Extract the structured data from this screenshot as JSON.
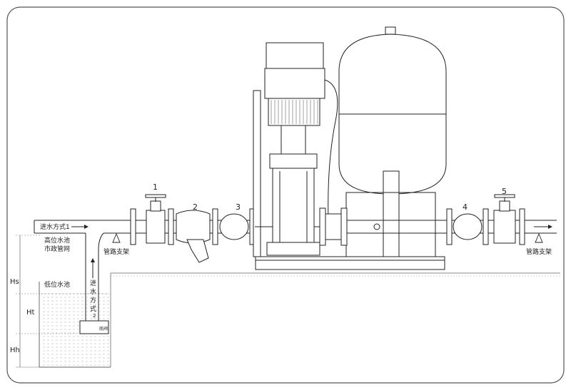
{
  "colors": {
    "line": "#1a1a1a",
    "frame": "#555555",
    "water": "#9a9a9a",
    "ground": "#888888",
    "paper": "#ffffff"
  },
  "numbers": [
    "1",
    "2",
    "3",
    "4",
    "5"
  ],
  "labels": {
    "inlet_mode_1": "进水方式1",
    "high_tank": "高位水池",
    "municipal": "市政管网",
    "pipe_support_left": "管路支架",
    "pipe_support_right": "管路支架",
    "low_tank": "低位水池",
    "bottom_valve": "底阀"
  },
  "inlet_mode_2": [
    "进",
    "水",
    "方",
    "式",
    "2"
  ],
  "dimensions": {
    "hs": "Hs",
    "ht": "Ht",
    "hh": "Hh"
  }
}
